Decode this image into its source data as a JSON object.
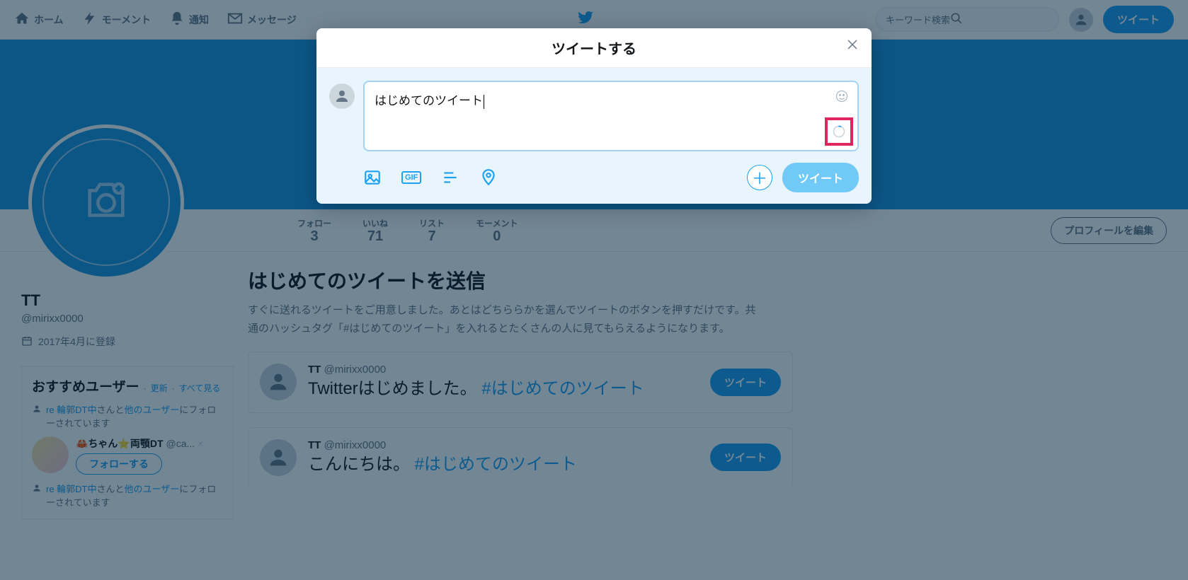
{
  "nav": {
    "home": "ホーム",
    "moments": "モーメント",
    "notifications": "通知",
    "messages": "メッセージ",
    "search_placeholder": "キーワード検索",
    "tweet_button": "ツイート"
  },
  "stats": {
    "follow_label": "フォロー",
    "follow_value": "3",
    "likes_label": "いいね",
    "likes_value": "71",
    "lists_label": "リスト",
    "lists_value": "7",
    "moments_label": "モーメント",
    "moments_value": "0",
    "edit_profile": "プロフィールを編集"
  },
  "profile": {
    "name": "TT",
    "handle": "@mirixx0000",
    "joined": "2017年4月に登録"
  },
  "suggest": {
    "title": "おすすめユーザー",
    "dot": "· ",
    "refresh": "更新",
    "see_all": "すべて見る",
    "reco_prefix": "re 輪郭DT中",
    "reco_mid1": "さんと",
    "reco_others": "他のユーザー",
    "reco_suffix": "にフォローされています",
    "user_name": "🦀ちゃん⭐両顎DT",
    "user_handle": "@ca...",
    "follow_btn": "フォローする"
  },
  "intro": {
    "heading": "はじめてのツイートを送信",
    "desc": "すぐに送れるツイートをご用意しました。あとはどちららかを選んでツイートのボタンを押すだけです。共通のハッシュタグ「#はじめてのツイート」を入れるとたくさんの人に見てもらえるようになります。"
  },
  "sample_tweets": [
    {
      "name": "TT",
      "handle": "@mirixx0000",
      "text": "Twitterはじめました。",
      "tag": "#はじめてのツイート",
      "button": "ツイート"
    },
    {
      "name": "TT",
      "handle": "@mirixx0000",
      "text": "こんにちは。",
      "tag": "#はじめてのツイート",
      "button": "ツイート"
    }
  ],
  "modal": {
    "title": "ツイートする",
    "compose_text": "はじめてのツイート",
    "tweet_button": "ツイート"
  }
}
